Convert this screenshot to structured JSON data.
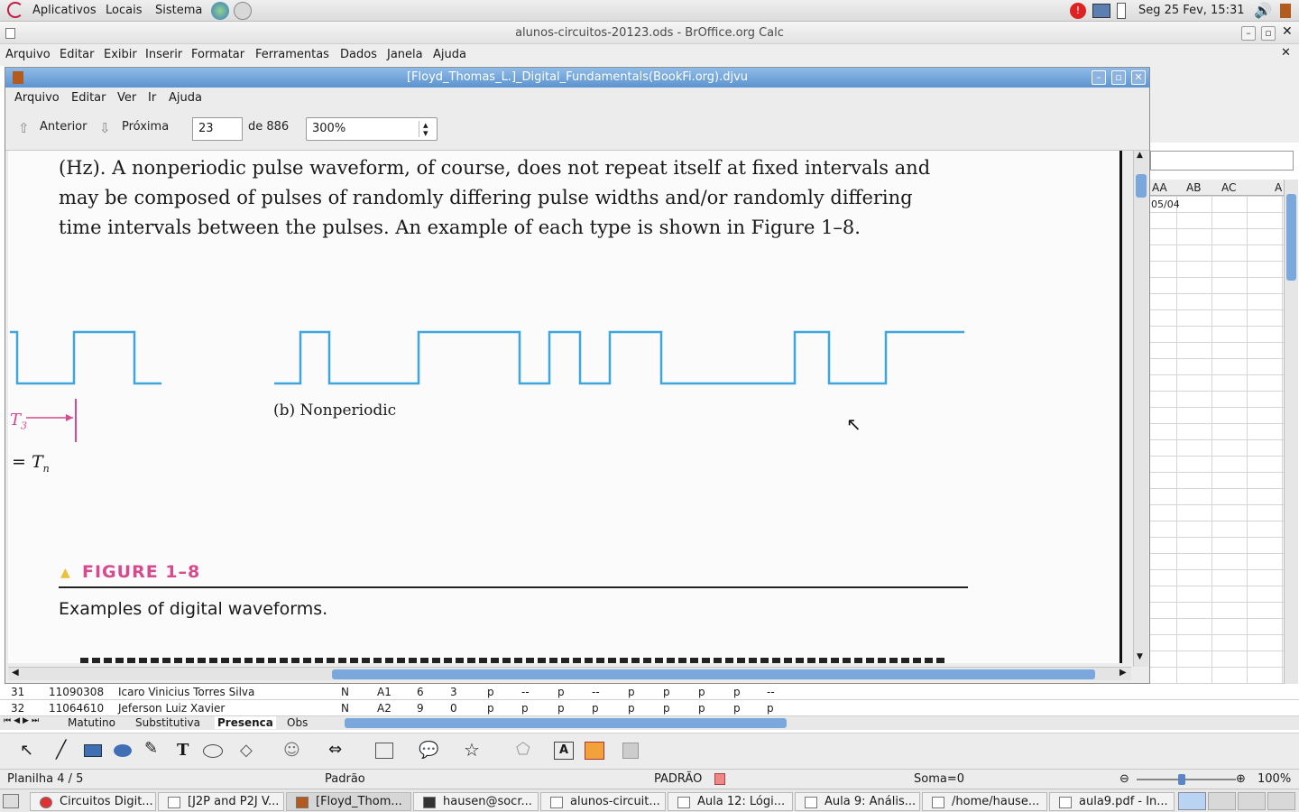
{
  "panel": {
    "menus": [
      "Aplicativos",
      "Locais",
      "Sistema"
    ],
    "clock": "Seg 25 Fev, 15:31"
  },
  "calc": {
    "title": "alunos-circuitos-20123.ods - BrOffice.org Calc",
    "menu": [
      "Arquivo",
      "Editar",
      "Exibir",
      "Inserir",
      "Formatar",
      "Ferramentas",
      "Dados",
      "Janela",
      "Ajuda"
    ],
    "col_headers": [
      "AA",
      "AB",
      "AC",
      "A"
    ],
    "cell_value": "05/04",
    "rows": [
      {
        "num": "31",
        "id": "11090308",
        "name": "Icaro Vinicius Torres Silva",
        "c1": "N",
        "c2": "A1",
        "c3": "6",
        "c4": "3",
        "marks": [
          "p",
          "--",
          "p",
          "--",
          "p",
          "p",
          "p",
          "p",
          "--"
        ]
      },
      {
        "num": "32",
        "id": "11064610",
        "name": "Jeferson Luiz Xavier",
        "c1": "N",
        "c2": "A2",
        "c3": "9",
        "c4": "0",
        "marks": [
          "p",
          "p",
          "p",
          "p",
          "p",
          "p",
          "p",
          "p",
          "p"
        ]
      }
    ],
    "sheet_tabs": [
      "Matutino",
      "Substitutiva",
      "Presenca",
      "Obs"
    ],
    "status": {
      "sheet": "Planilha 4 / 5",
      "style": "Padrão",
      "mode": "PADRÃO",
      "sum": "Soma=0",
      "zoom": "100%"
    }
  },
  "djvu": {
    "title": "[Floyd_Thomas_L.]_Digital_Fundamentals(BookFi.org).djvu",
    "menu": [
      "Arquivo",
      "Editar",
      "Ver",
      "Ir",
      "Ajuda"
    ],
    "prev_label": "Anterior",
    "next_label": "Próxima",
    "page": "23",
    "page_of": "de 886",
    "zoom": "300%",
    "lines": [
      "(Hz). A nonperiodic pulse waveform, of course, does not repeat itself at fixed intervals and",
      "may be composed of pulses of randomly differing pulse widths and/or randomly differing",
      "time intervals between the pulses. An example of each type is shown in Figure 1–8."
    ],
    "wave_label": "(b) Nonperiodic",
    "t3": "T",
    "t3_sub": "3",
    "tn_eq": "= T",
    "tn_sub": "n",
    "figure_title": "FIGURE 1–8",
    "figure_caption": "Examples of digital waveforms."
  },
  "taskbar": [
    "Circuitos Digit...",
    "[J2P and P2J V...",
    "[Floyd_Thom...",
    "hausen@socr...",
    "alunos-circuit...",
    "Aula 12: Lógi...",
    "Aula 9: Anális...",
    "/home/hause...",
    "aula9.pdf - In..."
  ],
  "colors": {
    "wave": "#3ea6dd",
    "figure": "#d64a8e",
    "titlebar": "#6fa3dc"
  }
}
